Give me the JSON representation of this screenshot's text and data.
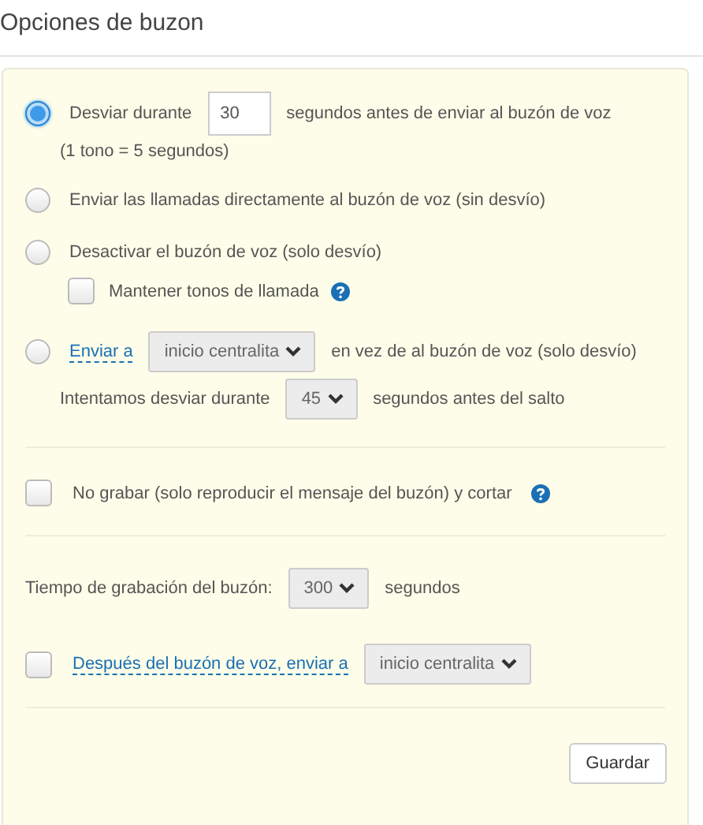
{
  "dialog": {
    "title": "Opciones de buzon"
  },
  "forward_options": [
    {
      "kind": "timed",
      "selected": true,
      "label": "Desviar durante",
      "value": "30",
      "suffix": "segundos antes de enviar al buzón de voz",
      "note": "(1 tono = 5 segundos)"
    },
    {
      "kind": "plain",
      "selected": false,
      "label": "Enviar las llamadas directamente al buzón de voz (sin desvío)"
    },
    {
      "kind": "disable",
      "selected": false,
      "label": "Desactivar el buzón de voz (solo desvío)",
      "sub_checkbox": {
        "label": "Mantener tonos de llamada",
        "checked": false
      }
    },
    {
      "kind": "redirect",
      "selected": false,
      "link": "Enviar a",
      "target": "inicio centralita",
      "suffix": "en vez de al buzón de voz (solo desvío)",
      "retry_label": "Intentamos desviar durante",
      "retry_value": "45",
      "retry_suffix": "segundos antes del salto"
    }
  ],
  "no_record": {
    "checked": false,
    "label": "No grabar (solo reproducir el mensaje del buzón) y cortar"
  },
  "record_time": {
    "label": "Tiempo de grabación del buzón:",
    "value": "300",
    "suffix": "segundos"
  },
  "after_voicemail": {
    "checked": false,
    "link": "Después del buzón de voz, enviar a",
    "target": "inicio centralita"
  },
  "save_button": "Guardar"
}
